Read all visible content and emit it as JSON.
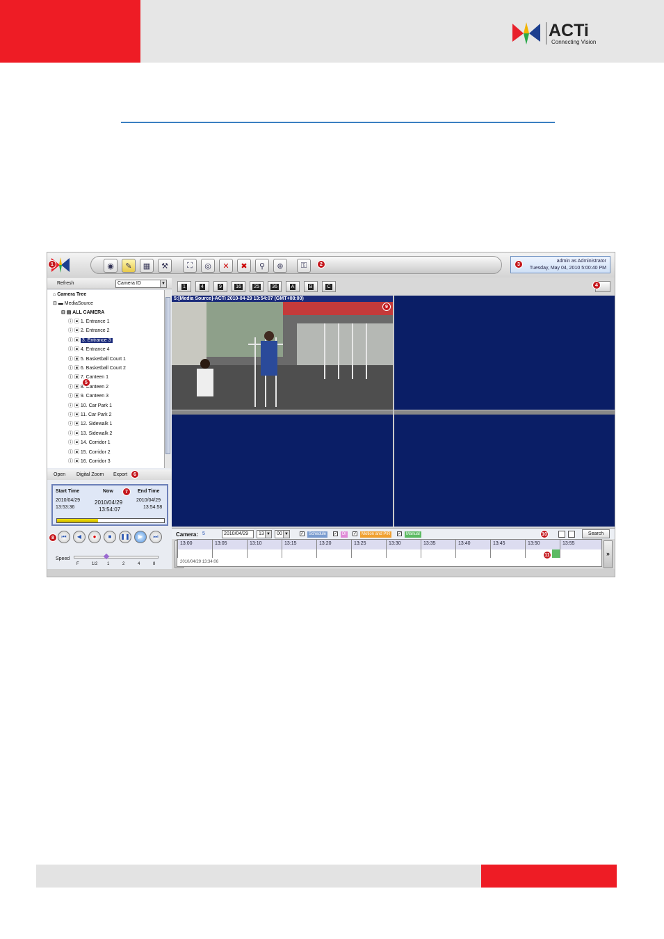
{
  "brand": {
    "name": "ACTi",
    "tagline": "Connecting Vision",
    "colors": {
      "red": "#ee1c25",
      "rule_blue": "#3a7fc1",
      "view_bg": "#0a1e66"
    }
  },
  "app": {
    "user_line1": "admin as Administrator",
    "user_line2": "Tuesday, May 04, 2010 5:00:40 PM",
    "toolbar_icons": [
      "eye-icon",
      "edit-icon",
      "map-icon",
      "tools-icon",
      "fullscreen-icon",
      "camera-icon",
      "disconnect-icon",
      "disconnect-all-icon",
      "search-icon",
      "zoom-icon",
      "key-icon"
    ],
    "refresh_label": "Refresh",
    "sort_select": "Camera ID",
    "tree": {
      "root": "Camera Tree",
      "source": "MediaSource",
      "group": "ALL CAMERA",
      "cameras": [
        "1. Entrance 1",
        "2. Entrance 2",
        "3. Entrance 3",
        "4. Entrance 4",
        "5. Basketball Court 1",
        "6. Basketball Court 2",
        "7. Canteen 1",
        "8. Canteen 2",
        "9. Canteen 3",
        "10. Car Park 1",
        "11. Car Park 2",
        "12. Sidewalk 1",
        "13. Sidewalk 2",
        "14. Corridor 1",
        "15. Corridor 2",
        "16. Corridor 3"
      ],
      "selected_index": 2
    },
    "actions": {
      "open": "Open",
      "zoom": "Digital Zoom",
      "export": "Export"
    },
    "timebox": {
      "start_label": "Start Time",
      "now_label": "Now",
      "end_label": "End Time",
      "start_date": "2010/04/29",
      "start_time": "13:53:36",
      "now_date": "2010/04/29",
      "now_time": "13:54:07",
      "end_date": "2010/04/29",
      "end_time": "13:54:58",
      "progress": 0.38
    },
    "playback_buttons": [
      "skip-start-icon",
      "rewind-icon",
      "record-icon",
      "stop-icon",
      "pause-icon",
      "play-icon",
      "skip-end-icon"
    ],
    "speed": {
      "label": "Speed",
      "ticks": [
        "F",
        "1/2",
        "1",
        "2",
        "4",
        "8"
      ],
      "value": "1"
    },
    "layout_buttons": [
      "1",
      "4",
      "9",
      "16",
      "25",
      "36",
      "A",
      "B",
      "C"
    ],
    "video_title": "5:[Media Source]-ACTi   2010-04-29 13:54:07 (GMT+08:00)",
    "camera_row": {
      "camera_label": "Camera:",
      "camera_value": "5",
      "date": "2010/04/29",
      "hour": "13",
      "minute": "00",
      "tags": [
        {
          "label": "Schedule",
          "color": "#7a9ccf"
        },
        {
          "label": "DI",
          "color": "#e08ad7"
        },
        {
          "label": "Motion and PIR",
          "color": "#f0a030"
        },
        {
          "label": "Manual",
          "color": "#5dbb63"
        }
      ],
      "search_label": "Search"
    },
    "timeline": {
      "labels": [
        "13:00",
        "13:05",
        "13:10",
        "13:15",
        "13:20",
        "13:25",
        "13:30",
        "13:35",
        "13:40",
        "13:45",
        "13:50",
        "13:55"
      ],
      "status": "2010/04/29 13:34:06"
    },
    "callouts": [
      "1",
      "2",
      "3",
      "4",
      "5",
      "6",
      "7",
      "8",
      "9",
      "10",
      "11"
    ]
  }
}
